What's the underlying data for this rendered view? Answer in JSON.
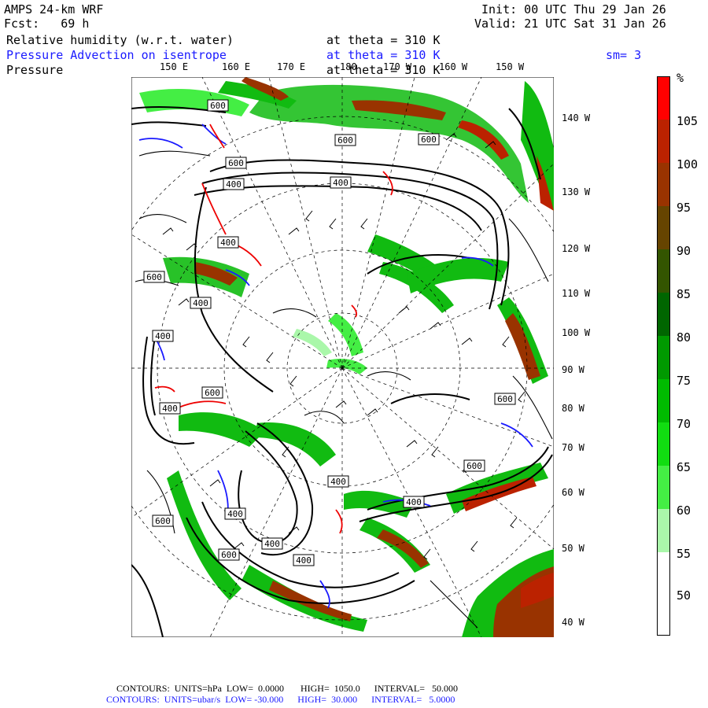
{
  "header": {
    "model": "AMPS 24-km WRF",
    "init": "Init: 00 UTC Thu 29 Jan 26",
    "fcst": "Fcst:   69 h",
    "valid": "Valid: 21 UTC Sat 31 Jan 26",
    "field1_name": "Relative humidity (w.r.t. water)",
    "field1_level": "at theta = 310 K",
    "field2_name": "Pressure Advection on isentrope",
    "field2_level": "at theta = 310 K",
    "smoothing": "sm= 3",
    "field3_name": "Pressure",
    "field3_level": "at theta = 310 K"
  },
  "top_lon_labels": [
    "150 E",
    "160 E",
    "170 E",
    "180",
    "170 W",
    "160 W",
    "150 W"
  ],
  "right_lon_labels": [
    "140 W",
    "130 W",
    "120 W",
    "110 W",
    "100 W",
    "90 W",
    "80 W",
    "70 W",
    "60 W",
    "50 W",
    "40 W"
  ],
  "contour_labels": [
    "600",
    "600",
    "400",
    "600",
    "600",
    "400",
    "400",
    "600",
    "400",
    "400",
    "600",
    "400",
    "600",
    "400",
    "600",
    "400",
    "600",
    "400",
    "600",
    "400",
    "400"
  ],
  "colorbar": {
    "unit": "%",
    "levels": [
      "105",
      "100",
      "95",
      "90",
      "85",
      "80",
      "75",
      "70",
      "65",
      "60",
      "55",
      "50"
    ],
    "colors": [
      "#ff0000",
      "#bb2200",
      "#993300",
      "#664400",
      "#335500",
      "#006600",
      "#009900",
      "#00bb00",
      "#11dd11",
      "#44ee44",
      "#aaf7aa",
      "#ffffff"
    ]
  },
  "footer": {
    "line1": "CONTOURS:  UNITS=hPa  LOW=  0.0000       HIGH=  1050.0      INTERVAL=   50.000",
    "line2": "CONTOURS:  UNITS=ubar/s  LOW= -30.000      HIGH=  30.000      INTERVAL=   5.0000"
  }
}
